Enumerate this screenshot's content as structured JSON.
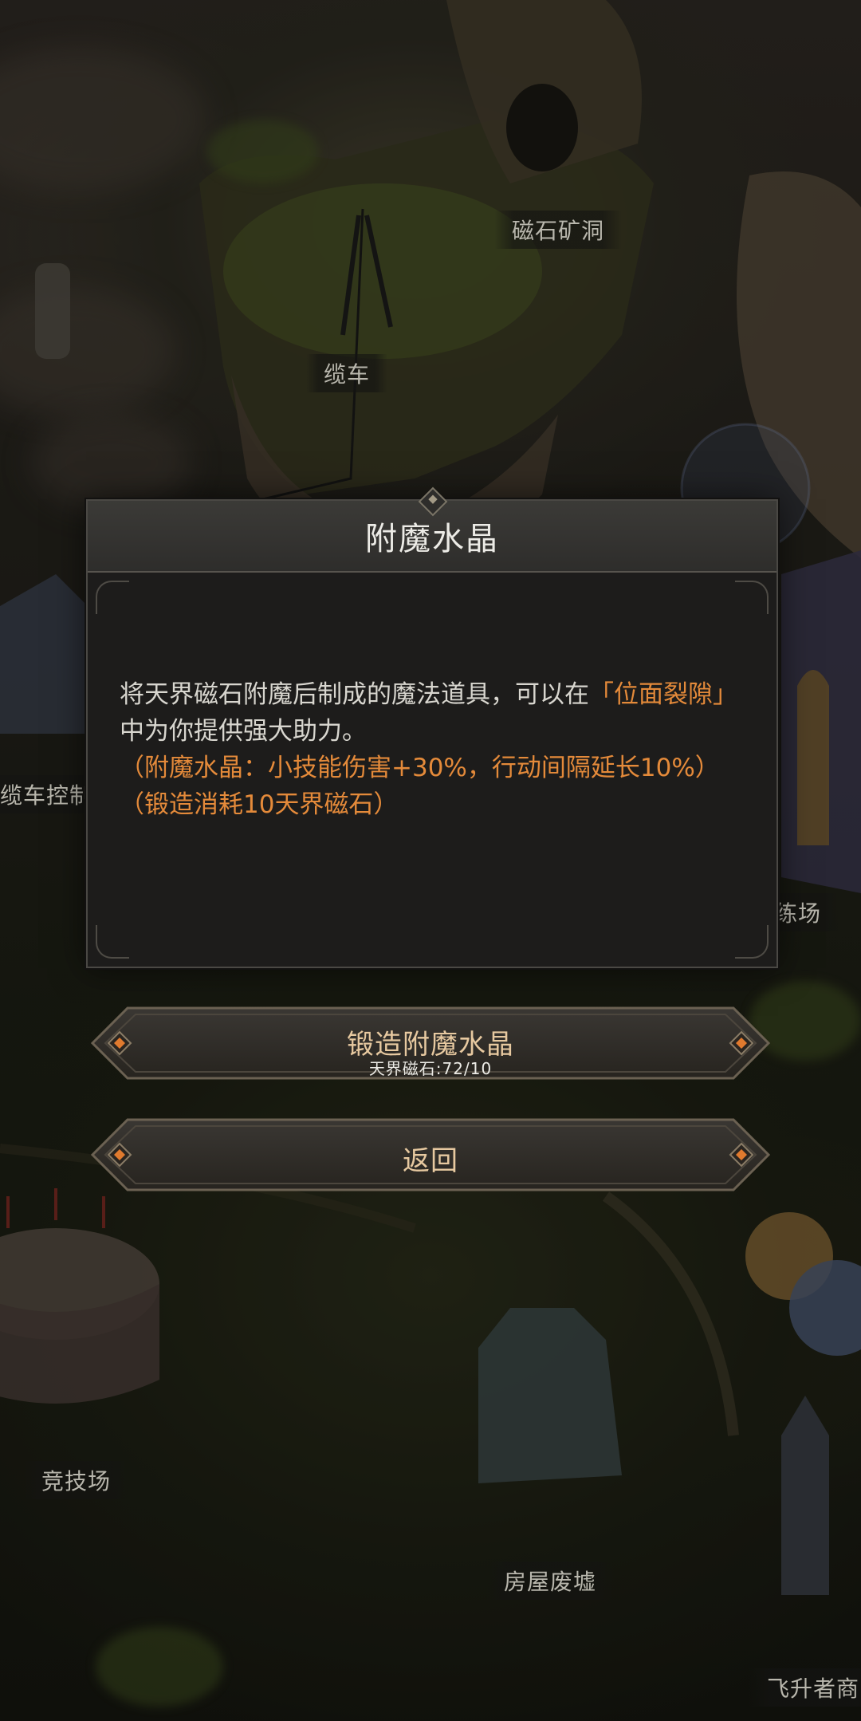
{
  "map": {
    "labels": {
      "magnet_cave": "磁石矿洞",
      "cable_car": "缆车",
      "cable_car_control": "缆车控制",
      "training_ground": "练场",
      "arena": "竞技场",
      "house_ruins": "房屋废墟",
      "ascender_shop": "飞升者商"
    }
  },
  "dialog": {
    "title": "附魔水晶",
    "description_before": "将天界磁石附魔后制成的魔法道具，可以在",
    "description_highlight": "「位面裂隙」",
    "description_after": "中为你提供强大助力。",
    "effect_line": "（附魔水晶：小技能伤害+30%，行动间隔延长10%）",
    "cost_line": "（锻造消耗10天界磁石）"
  },
  "buttons": {
    "forge_label": "锻造附魔水晶",
    "forge_sub": "天界磁石:72/10",
    "back_label": "返回"
  },
  "colors": {
    "highlight": "#e48a3a",
    "text": "#d8d6cf",
    "button_text": "#e7c9a0"
  }
}
